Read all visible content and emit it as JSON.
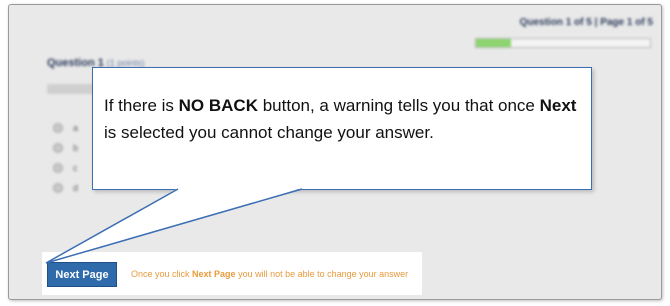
{
  "progress": {
    "question_of": "Question 1 of 5",
    "separator": "|",
    "page_of": "Page 1 of 5",
    "fraction": 0.2
  },
  "question": {
    "title": "Question 1",
    "points": "(1 points)",
    "options": [
      "a",
      "b",
      "c",
      "d"
    ]
  },
  "callout": {
    "part1": "If there is ",
    "bold1": "NO BACK",
    "part2": " button, a warning tells you that once ",
    "bold2": "Next",
    "part3": " is selected you cannot change your answer."
  },
  "footer": {
    "next_button": "Next Page",
    "warning_pre": "Once you click ",
    "warning_bold": "Next Page",
    "warning_post": " you will not be able to change your answer"
  },
  "colors": {
    "callout_border": "#3c6eb4",
    "button": "#2f6aab",
    "progress_fill": "#8cd46d",
    "warning_text": "#e89a3c"
  }
}
